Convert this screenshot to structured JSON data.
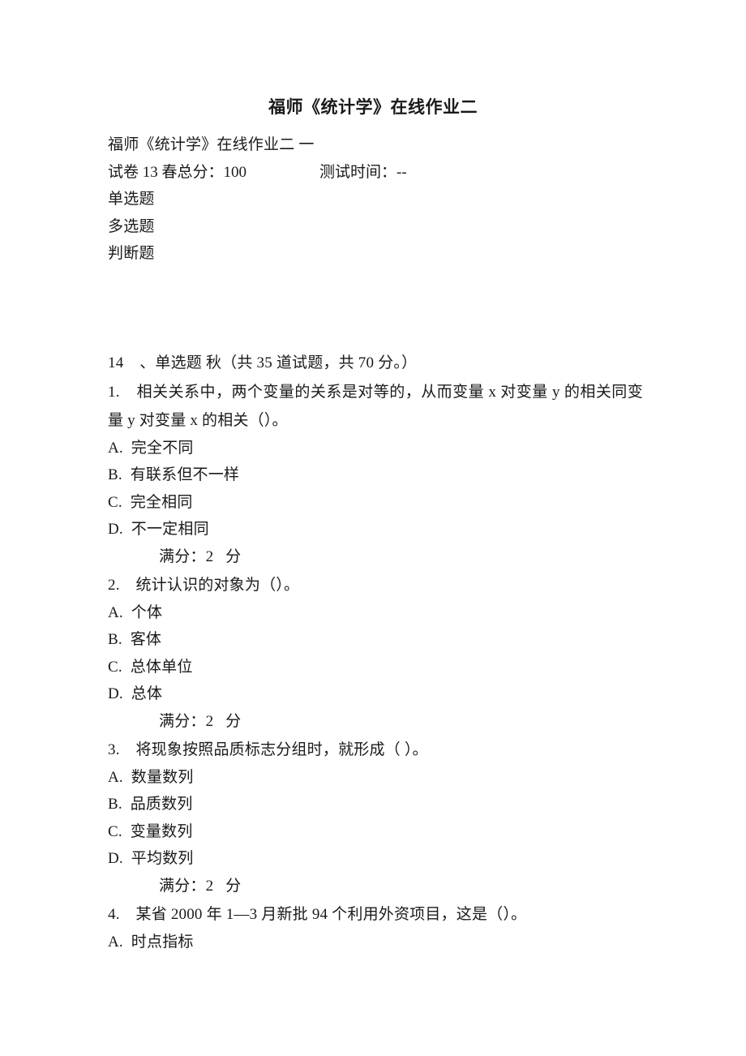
{
  "document": {
    "title": "福师《统计学》在线作业二",
    "header": {
      "subtitle": "福师《统计学》在线作业二 一",
      "paper_info": "试卷 13 春总分：100",
      "test_time": "测试时间：--"
    },
    "toc": [
      "单选题",
      "多选题",
      "判断题"
    ],
    "section": {
      "heading": "14    、单选题 秋（共 35 道试题，共 70 分。）"
    },
    "questions": [
      {
        "number": "1.",
        "stem": "相关关系中，两个变量的关系是对等的，从而变量 x 对变量 y 的相关同变量 y 对变量 x 的相关（）。",
        "options": [
          "A.  完全不同",
          "B.  有联系但不一样",
          "C.  完全相同",
          "D.  不一定相同"
        ],
        "score": "满分：2   分"
      },
      {
        "number": "2.",
        "stem": "统计认识的对象为（）。",
        "options": [
          "A.  个体",
          "B.  客体",
          "C.  总体单位",
          "D.  总体"
        ],
        "score": "满分：2   分"
      },
      {
        "number": "3.",
        "stem": "将现象按照品质标志分组时，就形成（ ）。",
        "options": [
          "A.  数量数列",
          "B.  品质数列",
          "C.  变量数列",
          "D.  平均数列"
        ],
        "score": "满分：2   分"
      },
      {
        "number": "4.",
        "stem": "某省 2000 年 1—3 月新批 94 个利用外资项目，这是（）。",
        "options": [
          "A.  时点指标"
        ],
        "score": ""
      }
    ]
  }
}
